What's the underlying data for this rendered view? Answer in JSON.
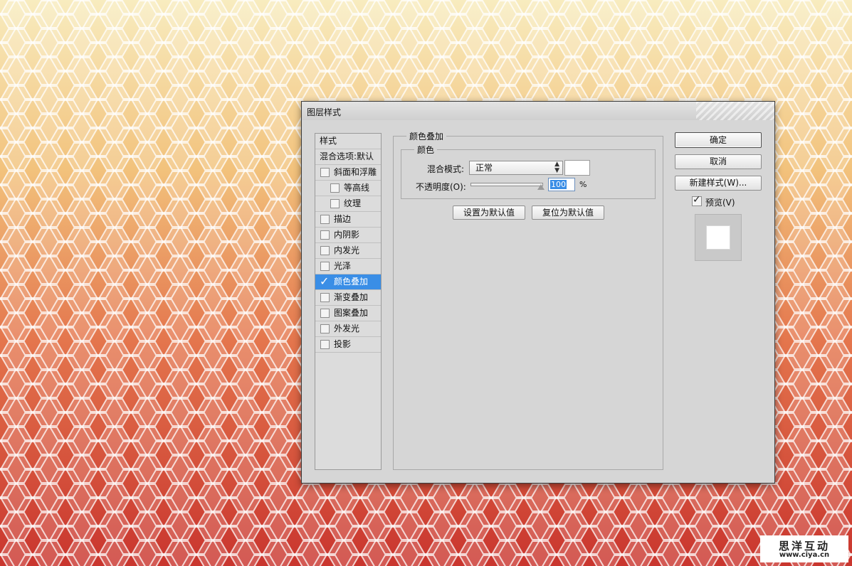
{
  "dialog": {
    "title": "图层样式"
  },
  "styles_list": {
    "header": "样式",
    "blend_options": "混合选项:默认",
    "items": [
      {
        "label": "斜面和浮雕",
        "checked": false,
        "indent": false
      },
      {
        "label": "等高线",
        "checked": false,
        "indent": true
      },
      {
        "label": "纹理",
        "checked": false,
        "indent": true
      },
      {
        "label": "描边",
        "checked": false,
        "indent": false
      },
      {
        "label": "内阴影",
        "checked": false,
        "indent": false
      },
      {
        "label": "内发光",
        "checked": false,
        "indent": false
      },
      {
        "label": "光泽",
        "checked": false,
        "indent": false
      },
      {
        "label": "颜色叠加",
        "checked": true,
        "indent": false,
        "selected": true
      },
      {
        "label": "渐变叠加",
        "checked": false,
        "indent": false
      },
      {
        "label": "图案叠加",
        "checked": false,
        "indent": false
      },
      {
        "label": "外发光",
        "checked": false,
        "indent": false
      },
      {
        "label": "投影",
        "checked": false,
        "indent": false
      }
    ]
  },
  "color_overlay": {
    "section_title": "颜色叠加",
    "subsection_title": "颜色",
    "blend_mode_label": "混合模式:",
    "blend_mode_value": "正常",
    "overlay_color": "#ffffff",
    "opacity_label": "不透明度(O):",
    "opacity_value": "100",
    "opacity_unit": "%",
    "opacity_fraction": 1.0,
    "set_default_label": "设置为默认值",
    "reset_default_label": "复位为默认值"
  },
  "actions": {
    "ok_label": "确定",
    "cancel_label": "取消",
    "new_style_label": "新建样式(W)...",
    "preview_label": "预览(V)",
    "preview_checked": true
  },
  "watermark": {
    "name": "思洋互动",
    "url": "www.ciya.cn"
  },
  "colors": {
    "selection": "#3a8ee6",
    "dialog_bg": "#d6d6d6"
  }
}
